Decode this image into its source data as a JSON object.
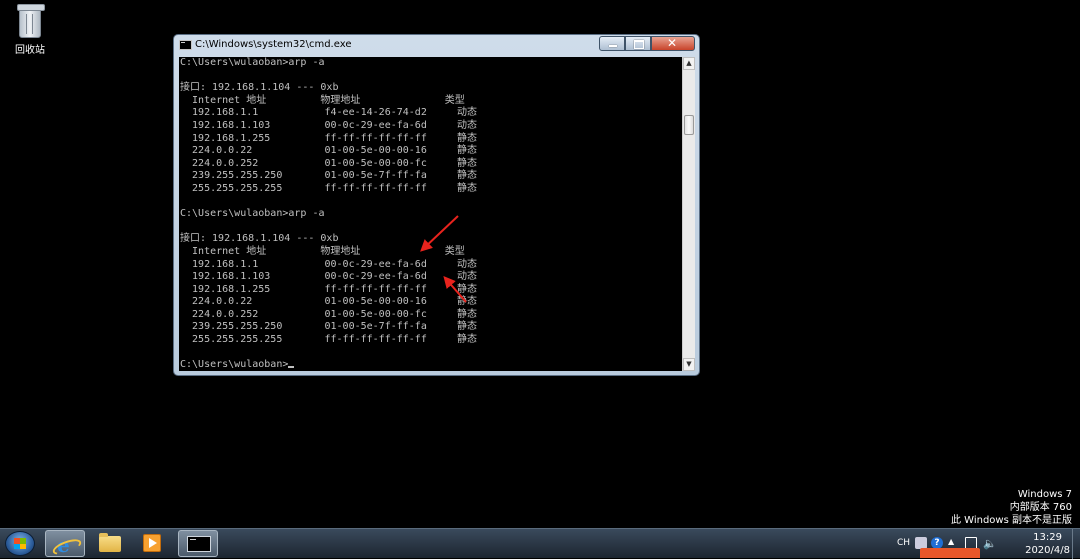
{
  "desktop": {
    "recycle_bin_label": "回收站"
  },
  "window": {
    "title": "C:\\Windows\\system32\\cmd.exe",
    "minimize_icon": "minimize-icon",
    "maximize_icon": "maximize-icon",
    "close_icon": "close-icon"
  },
  "console": {
    "lines": [
      "C:\\Users\\wulaoban>arp -a",
      "",
      "接口: 192.168.1.104 --- 0xb",
      "  Internet 地址         物理地址              类型",
      "  192.168.1.1           f4-ee-14-26-74-d2     动态",
      "  192.168.1.103         00-0c-29-ee-fa-6d     动态",
      "  192.168.1.255         ff-ff-ff-ff-ff-ff     静态",
      "  224.0.0.22            01-00-5e-00-00-16     静态",
      "  224.0.0.252           01-00-5e-00-00-fc     静态",
      "  239.255.255.250       01-00-5e-7f-ff-fa     静态",
      "  255.255.255.255       ff-ff-ff-ff-ff-ff     静态",
      "",
      "C:\\Users\\wulaoban>arp -a",
      "",
      "接口: 192.168.1.104 --- 0xb",
      "  Internet 地址         物理地址              类型",
      "  192.168.1.1           00-0c-29-ee-fa-6d     动态",
      "  192.168.1.103         00-0c-29-ee-fa-6d     动态",
      "  192.168.1.255         ff-ff-ff-ff-ff-ff     静态",
      "  224.0.0.22            01-00-5e-00-00-16     静态",
      "  224.0.0.252           01-00-5e-00-00-fc     静态",
      "  239.255.255.250       01-00-5e-7f-ff-fa     静态",
      "  255.255.255.255       ff-ff-ff-ff-ff-ff     静态",
      ""
    ],
    "prompt": "C:\\Users\\wulaoban>"
  },
  "watermark": {
    "line1": "Windows 7",
    "line2": "内部版本 760",
    "line3": "此 Windows 副本不是正版"
  },
  "taskbar": {
    "apps": [
      "start-orb-icon",
      "internet-explorer-icon",
      "explorer-folder-icon",
      "media-player-icon",
      "cmd-icon"
    ],
    "language": "CH",
    "time": "13:29",
    "date": "2020/4/8"
  },
  "colors": {
    "console_bg": "#000000",
    "console_text": "#c0c0c0",
    "annotation_arrow": "#e8231d"
  }
}
